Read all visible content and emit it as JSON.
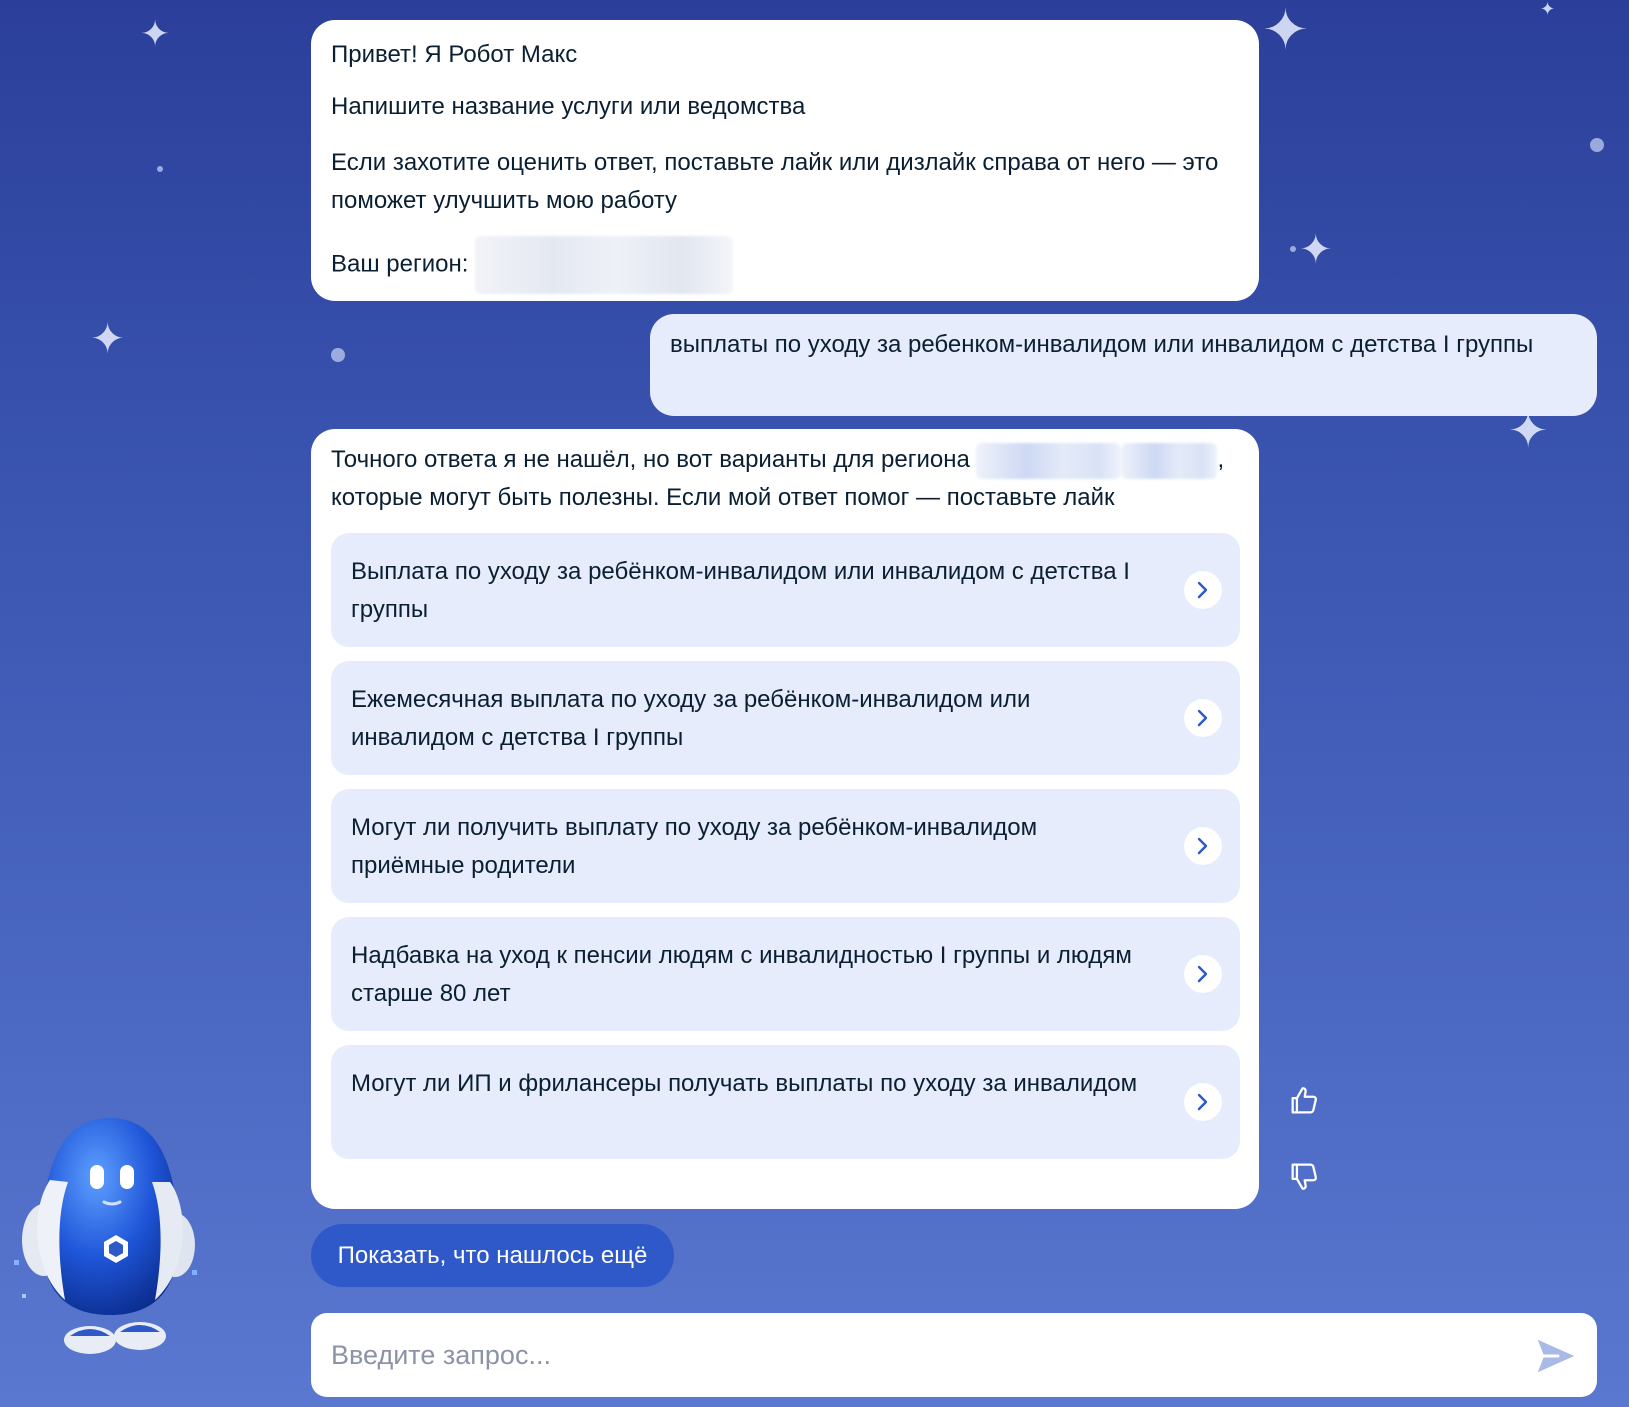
{
  "greeting": {
    "line1": "Привет! Я Робот Макс",
    "line2": "Напишите название услуги или ведомства",
    "line3": "Если захотите оценить ответ, поставьте лайк или дизлайк справа от него — это поможет улучшить мою работу",
    "region_label": "Ваш регион:"
  },
  "user_message": {
    "text": "выплаты по уходу за ребенком-инвалидом или инвалидом с детства I группы"
  },
  "answer": {
    "intro_part1": "Точного ответа я не нашёл, но вот варианты для региона",
    "intro_part2": ", которые могут быть полезны. Если мой ответ помог — поставьте лайк",
    "options": [
      {
        "label": "Выплата по уходу за ребёнком-инвалидом или инвалидом с детства I группы"
      },
      {
        "label": "Ежемесячная выплата по уходу за ребёнком-инвалидом или инвалидом с детства I группы"
      },
      {
        "label": "Могут ли получить выплату по уходу за ребёнком-инвалидом приёмные родители"
      },
      {
        "label": "Надбавка на уход к пенсии людям с инвалидностью I группы и людям старше 80 лет"
      },
      {
        "label": "Могут ли ИП и фрилансеры получать выплаты по уходу за инвалидом"
      }
    ]
  },
  "feedback": {
    "like_icon": "thumbs-up-icon",
    "dislike_icon": "thumbs-down-icon"
  },
  "more_button": {
    "label": "Показать, что нашлось ещё"
  },
  "input": {
    "placeholder": "Введите запрос...",
    "value": ""
  },
  "send_icon": "send-icon",
  "mascot_icon": "robot-max-mascot",
  "colors": {
    "accent": "#2f58c8",
    "card_background": "#e6ecfb",
    "text": "#0b1f33",
    "placeholder": "#8a94a6",
    "send_icon": "#a9b9e8"
  }
}
